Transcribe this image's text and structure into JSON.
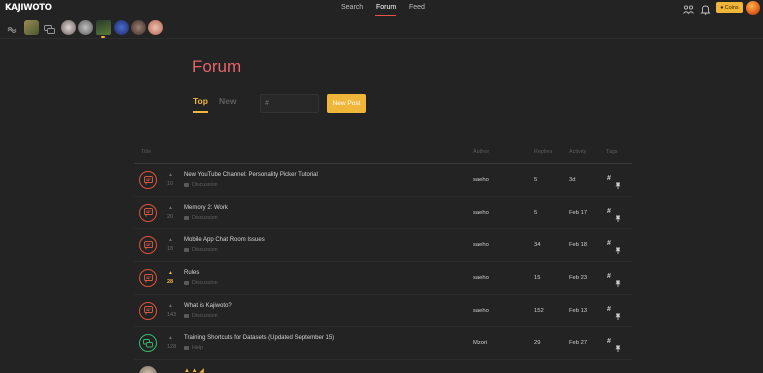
{
  "app": {
    "logo": "KAJIWOTO"
  },
  "nav": {
    "search": "Search",
    "forum": "Forum",
    "feed": "Feed"
  },
  "header": {
    "coins_label": "Coins"
  },
  "friends": [
    {
      "icon": "link-icon"
    },
    {
      "icon": "landscape-avatar",
      "color": "#7a6a3a"
    },
    {
      "icon": "chat-icon"
    },
    {
      "color": "#b8b0b0"
    },
    {
      "color": "#8a8a8a"
    },
    {
      "color": "#4a6a3a"
    },
    {
      "color": "#2f4fa0"
    },
    {
      "color": "#6b5a50"
    },
    {
      "color": "#d9a08a"
    }
  ],
  "forum": {
    "title": "Forum",
    "tabs": {
      "top": "Top",
      "new": "New"
    },
    "tag_placeholder": "#",
    "new_post_label": "New Post"
  },
  "table": {
    "columns": {
      "title": "Title",
      "author": "Author",
      "replies": "Replies",
      "activity": "Activity",
      "tags": "Tags"
    },
    "rows": [
      {
        "votes": "10",
        "title": "New YouTube Channel: Personality Picker Tutorial",
        "category": "Discussion",
        "author": "saeho",
        "replies": "5",
        "activity": "3d",
        "hot": false,
        "type": "discussion"
      },
      {
        "votes": "20",
        "title": "Memory 2: Work",
        "category": "Discussion",
        "author": "saeho",
        "replies": "5",
        "activity": "Feb 17",
        "hot": false,
        "type": "discussion"
      },
      {
        "votes": "18",
        "title": "Mobile App Chat Room Issues",
        "category": "Discussion",
        "author": "saeho",
        "replies": "34",
        "activity": "Feb 18",
        "hot": false,
        "type": "discussion"
      },
      {
        "votes": "28",
        "title": "Rules",
        "category": "Discussion",
        "author": "saeho",
        "replies": "15",
        "activity": "Feb 23",
        "hot": true,
        "type": "discussion"
      },
      {
        "votes": "143",
        "title": "What is Kajiwoto?",
        "category": "Discussion",
        "author": "saeho",
        "replies": "152",
        "activity": "Feb 13",
        "hot": false,
        "type": "discussion"
      },
      {
        "votes": "128",
        "title": "Training Shortcuts for Datasets (Updated September 15)",
        "category": "Help",
        "author": "Mzori",
        "replies": "29",
        "activity": "Feb 27",
        "hot": false,
        "type": "help"
      }
    ],
    "tag_symbol": "#"
  },
  "colors": {
    "accent": "#f0b63a",
    "forum_title": "#e5646a",
    "discussion": "#d9533b",
    "help": "#3bb76f",
    "background": "#232323"
  }
}
